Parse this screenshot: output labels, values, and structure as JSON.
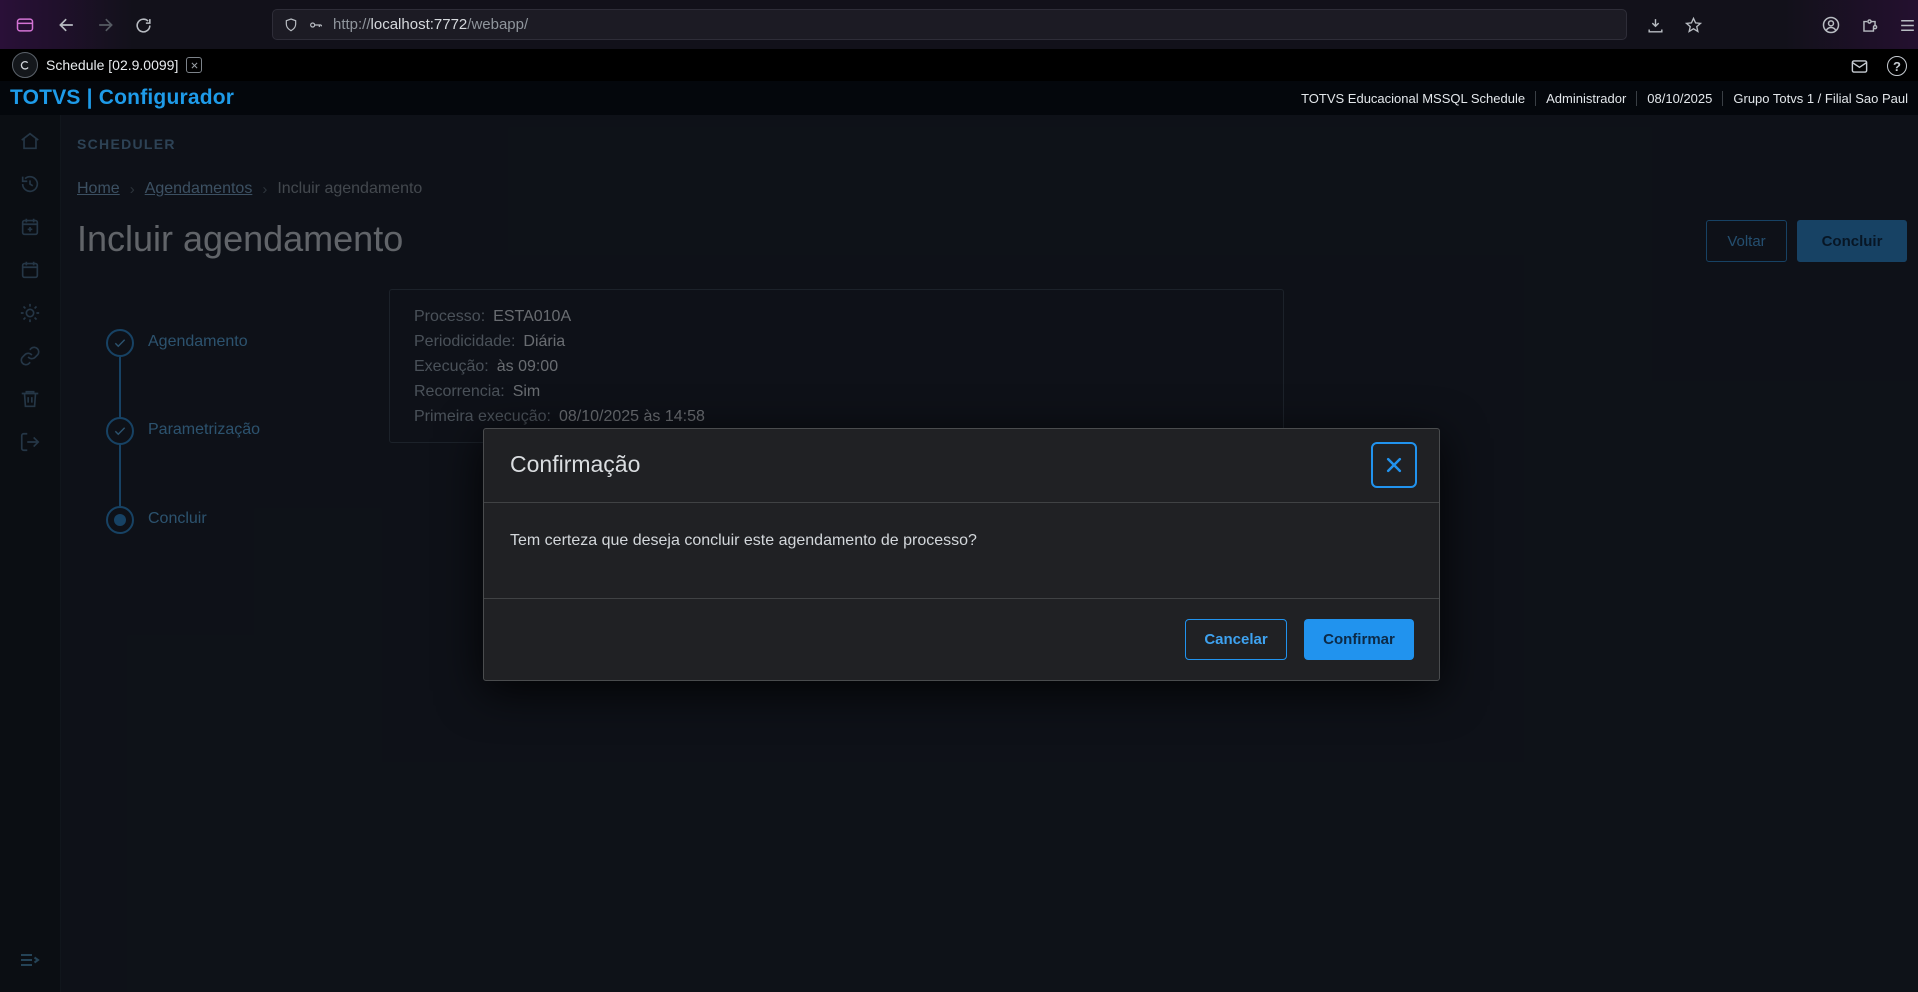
{
  "colors": {
    "accent": "#2193ee",
    "brand_blue": "#1e9be9",
    "stepper_blue": "#2e86c8"
  },
  "browser": {
    "url_scheme": "http://",
    "url_host": "localhost:7772",
    "url_path": "/webapp/"
  },
  "tabbar": {
    "tab_title": "Schedule [02.9.0099]",
    "help_glyph": "?"
  },
  "header": {
    "brand": "TOTVS | Configurador",
    "environment": "TOTVS Educacional MSSQL Schedule",
    "user": "Administrador",
    "date": "08/10/2025",
    "company": "Grupo Totvs 1 / Filial Sao Paul"
  },
  "sidebar": {
    "icons": [
      "home",
      "history",
      "calendar-add",
      "calendar",
      "settings",
      "link",
      "trash",
      "sign-out",
      "expand-menu"
    ]
  },
  "page": {
    "section": "SCHEDULER",
    "breadcrumb": {
      "items": [
        "Home",
        "Agendamentos",
        "Incluir agendamento"
      ],
      "separator": "›"
    },
    "title": "Incluir agendamento",
    "actions": {
      "back": "Voltar",
      "finish": "Concluir"
    }
  },
  "stepper": {
    "steps": [
      {
        "label": "Agendamento",
        "state": "done"
      },
      {
        "label": "Parametrização",
        "state": "done"
      },
      {
        "label": "Concluir",
        "state": "active"
      }
    ]
  },
  "summary": {
    "fields": [
      {
        "label": "Processo:",
        "value": "ESTA010A"
      },
      {
        "label": "Periodicidade:",
        "value": "Diária"
      },
      {
        "label": "Execução:",
        "value": "às 09:00"
      },
      {
        "label": "Recorrencia:",
        "value": "Sim"
      },
      {
        "label": "Primeira execução:",
        "value": "08/10/2025 às 14:58"
      }
    ]
  },
  "modal": {
    "title": "Confirmação",
    "message": "Tem certeza que deseja concluir este agendamento de processo?",
    "cancel_label": "Cancelar",
    "confirm_label": "Confirmar"
  }
}
